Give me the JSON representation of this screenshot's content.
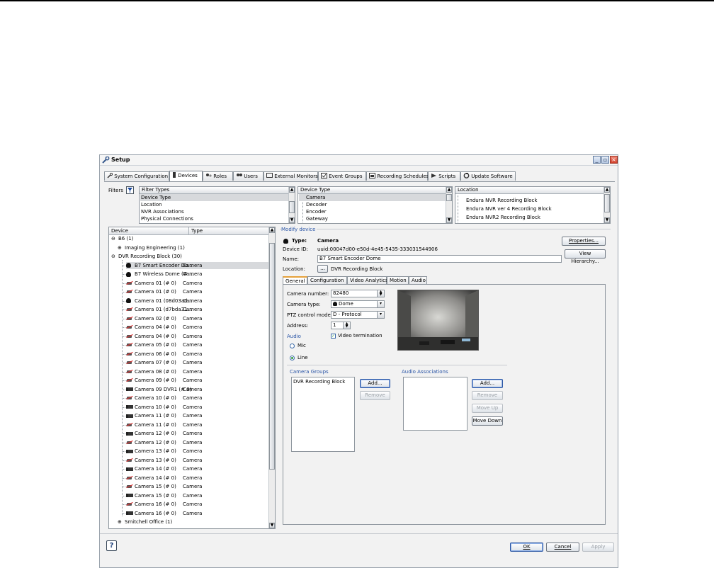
{
  "window": {
    "title": "Setup",
    "controls": [
      "minimize-icon",
      "maximize-icon",
      "close-icon"
    ]
  },
  "tabs": [
    {
      "label": "System Configuration",
      "icon": "wrench-icon"
    },
    {
      "label": "Devices",
      "icon": "device-icon",
      "active": true
    },
    {
      "label": "Roles",
      "icon": "roles-icon"
    },
    {
      "label": "Users",
      "icon": "users-icon"
    },
    {
      "label": "External Monitors",
      "icon": "monitor-icon"
    },
    {
      "label": "Event Groups",
      "icon": "event-icon"
    },
    {
      "label": "Recording Schedules",
      "icon": "schedule-icon"
    },
    {
      "label": "Scripts",
      "icon": "scripts-icon"
    },
    {
      "label": "Update Software",
      "icon": "update-icon"
    }
  ],
  "filters": {
    "label": "Filters",
    "filter_types": {
      "header": "Filter Types",
      "items": [
        "Device Type",
        "Location",
        "NVR Associations",
        "Physical Connections"
      ],
      "selected": 0
    },
    "device_type": {
      "header": "Device Type",
      "items": [
        "Camera",
        "Decoder",
        "Encoder",
        "Gateway"
      ],
      "selected": 0
    },
    "location": {
      "header": "Location",
      "items": [
        "Endura NVR Recording Block",
        "Endura NVR ver 4 Recording Block",
        "Endura NVR2 Recording Block"
      ]
    }
  },
  "device_tree": {
    "col_device": "Device",
    "col_type": "Type",
    "groups": [
      {
        "label": "B6 (1)",
        "expanded": true
      },
      {
        "label": "Imaging Engineering (1)",
        "expanded": false
      },
      {
        "label": "DVR Recording Block (30)",
        "expanded": true
      }
    ],
    "rows": [
      {
        "name": "B7 Smart Encoder Do...",
        "type": "Camera",
        "icon": "dome",
        "selected": true
      },
      {
        "name": "B7 Wireless Dome (# ...",
        "type": "Camera",
        "icon": "dome"
      },
      {
        "name": "Camera 01 (# 0)",
        "type": "Camera",
        "icon": "nf"
      },
      {
        "name": "Camera 01 (# 0)",
        "type": "Camera",
        "icon": "nf"
      },
      {
        "name": "Camera 01 (08d03ad...",
        "type": "Camera",
        "icon": "dome"
      },
      {
        "name": "Camera 01 (d7bda31...",
        "type": "Camera",
        "icon": "nf"
      },
      {
        "name": "Camera 02 (# 0)",
        "type": "Camera",
        "icon": "nf"
      },
      {
        "name": "Camera 04 (# 0)",
        "type": "Camera",
        "icon": "nf"
      },
      {
        "name": "Camera 04 (# 0)",
        "type": "Camera",
        "icon": "nf"
      },
      {
        "name": "Camera 05 (# 0)",
        "type": "Camera",
        "icon": "nf"
      },
      {
        "name": "Camera 06 (# 0)",
        "type": "Camera",
        "icon": "nf"
      },
      {
        "name": "Camera 07 (# 0)",
        "type": "Camera",
        "icon": "nf"
      },
      {
        "name": "Camera 08 (# 0)",
        "type": "Camera",
        "icon": "nf"
      },
      {
        "name": "Camera 09 (# 0)",
        "type": "Camera",
        "icon": "nf"
      },
      {
        "name": "Camera 09 DVR1 (# 0)",
        "type": "Camera",
        "icon": "box"
      },
      {
        "name": "Camera 10 (# 0)",
        "type": "Camera",
        "icon": "nf"
      },
      {
        "name": "Camera 10 (# 0)",
        "type": "Camera",
        "icon": "box"
      },
      {
        "name": "Camera 11 (# 0)",
        "type": "Camera",
        "icon": "box"
      },
      {
        "name": "Camera 11 (# 0)",
        "type": "Camera",
        "icon": "nf"
      },
      {
        "name": "Camera 12 (# 0)",
        "type": "Camera",
        "icon": "box"
      },
      {
        "name": "Camera 12 (# 0)",
        "type": "Camera",
        "icon": "nf"
      },
      {
        "name": "Camera 13 (# 0)",
        "type": "Camera",
        "icon": "box"
      },
      {
        "name": "Camera 13 (# 0)",
        "type": "Camera",
        "icon": "nf"
      },
      {
        "name": "Camera 14 (# 0)",
        "type": "Camera",
        "icon": "box"
      },
      {
        "name": "Camera 14 (# 0)",
        "type": "Camera",
        "icon": "nf"
      },
      {
        "name": "Camera 15 (# 0)",
        "type": "Camera",
        "icon": "nf"
      },
      {
        "name": "Camera 15 (# 0)",
        "type": "Camera",
        "icon": "box"
      },
      {
        "name": "Camera 16 (# 0)",
        "type": "Camera",
        "icon": "nf"
      },
      {
        "name": "Camera 16 (# 0)",
        "type": "Camera",
        "icon": "box"
      }
    ],
    "footer_group": {
      "label": "Smitchell Office (1)",
      "expanded": false
    }
  },
  "modify": {
    "legend": "Modify device",
    "type_label": "Type:",
    "type_value": "Camera",
    "device_id_label": "Device ID:",
    "device_id_value": "uuid:00047d00-e50d-4e45-5435-333031544906",
    "name_label": "Name:",
    "name_value": "B7 Smart Encoder Dome",
    "location_label": "Location:",
    "location_button": "...",
    "location_value": "DVR Recording Block",
    "properties_button": "Properties...",
    "view_hierarchy_button": "View Hierarchy..."
  },
  "subtabs": [
    {
      "label": "General",
      "active": true
    },
    {
      "label": "Configuration"
    },
    {
      "label": "Video Analytics"
    },
    {
      "label": "Motion"
    },
    {
      "label": "Audio"
    }
  ],
  "general": {
    "camera_number_label": "Camera number:",
    "camera_number_value": "82480",
    "camera_type_label": "Camera type:",
    "camera_type_value": "Dome",
    "ptz_label": "PTZ control mode:",
    "ptz_value": "D - Protocol",
    "address_label": "Address:",
    "address_value": "1",
    "audio_label": "Audio",
    "video_termination_label": "Video termination",
    "video_termination_checked": true,
    "audio_mic": "Mic",
    "audio_line": "Line",
    "audio_selected": "Line"
  },
  "camera_groups": {
    "legend": "Camera Groups",
    "items": [
      "DVR Recording Block"
    ],
    "add": "Add...",
    "remove": "Remove"
  },
  "audio_assoc": {
    "legend": "Audio Associations",
    "items": [],
    "add": "Add...",
    "remove": "Remove",
    "move_up": "Move Up",
    "move_down": "Move Down"
  },
  "footer": {
    "ok": "OK",
    "cancel": "Cancel",
    "apply": "Apply"
  }
}
